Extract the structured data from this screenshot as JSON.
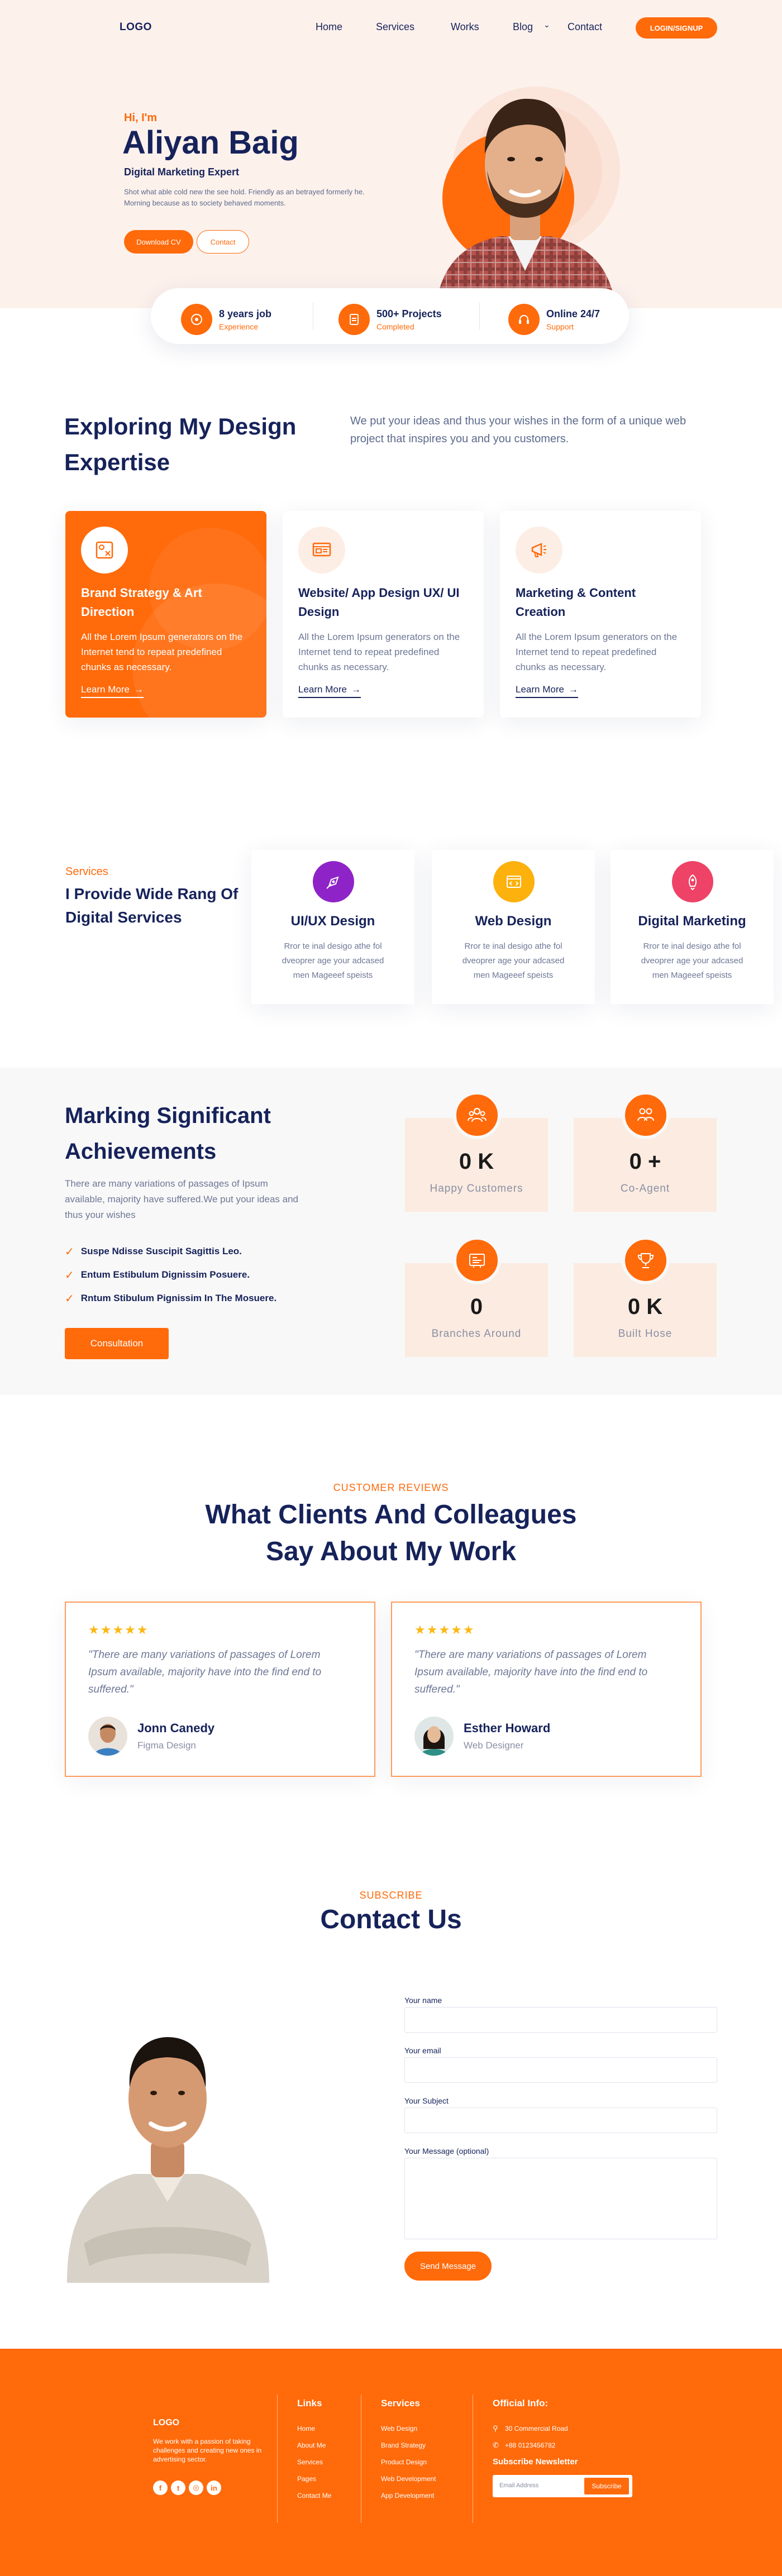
{
  "nav": {
    "logo": "LOGO",
    "links": [
      "Home",
      "Services",
      "Works",
      "Blog",
      "Contact"
    ],
    "cta": "LOGIN/SIGNUP"
  },
  "hero": {
    "greeting": "Hi, I'm",
    "name": "Aliyan Baig",
    "role": "Digital Marketing Expert",
    "description": "Shot what able cold new the see hold. Friendly as an betrayed formerly he. Morning because as to society behaved moments.",
    "download_cv": "Download CV",
    "contact": "Contact"
  },
  "stats": [
    {
      "title": "8 years job",
      "sub": "Experience",
      "icon": "briefcase-icon"
    },
    {
      "title": "500+ Projects",
      "sub": "Completed",
      "icon": "clipboard-icon"
    },
    {
      "title": "Online 24/7",
      "sub": "Support",
      "icon": "headset-icon"
    }
  ],
  "expertise": {
    "title": "Exploring My Design Expertise",
    "description": "We put your ideas and thus your wishes in the form of a unique web project that inspires you and you customers.",
    "cards": [
      {
        "title": "Brand Strategy & Art Direction",
        "desc": "All the Lorem Ipsum generators on the Internet tend to repeat predefined chunks as necessary.",
        "link": "Learn More",
        "icon": "brand-strategy-icon"
      },
      {
        "title": "Website/ App Design UX/ UI Design",
        "desc": "All the Lorem Ipsum generators on the Internet tend to repeat predefined chunks as necessary.",
        "link": "Learn More",
        "icon": "web-design-icon"
      },
      {
        "title": "Marketing & Content Creation",
        "desc": "All the Lorem Ipsum generators on the Internet tend to repeat predefined chunks as necessary.",
        "link": "Learn More",
        "icon": "marketing-icon"
      }
    ]
  },
  "services": {
    "eyebrow": "Services",
    "title": "I Provide Wide Rang Of Digital Services",
    "items": [
      {
        "title": "UI/UX Design",
        "desc": "Rror te inal desigo athe fol dveoprer age your adcased men Mageeef speists",
        "color": "#8e24c8",
        "icon": "ux-design-icon"
      },
      {
        "title": "Web Design",
        "desc": "Rror te inal desigo athe fol dveoprer age your adcased men Mageeef speists",
        "color": "#fcb10d",
        "icon": "web-browser-icon"
      },
      {
        "title": "Digital Marketing",
        "desc": "Rror te inal desigo athe fol dveoprer age your adcased men Mageeef speists",
        "color": "#ee4266",
        "icon": "rocket-icon"
      }
    ]
  },
  "achievements": {
    "title": "Marking Significant Achievements",
    "description": "There are many variations of passages of Ipsum available, majority have suffered.We put your ideas and thus your wishes",
    "bullets": [
      "Suspe Ndisse Suscipit Sagittis Leo.",
      "Entum Estibulum Dignissim Posuere.",
      "Rntum Stibulum Pignissim In The Mosuere."
    ],
    "button": "Consultation",
    "boxes": [
      {
        "num": "0 K",
        "label": "Happy Customers",
        "icon": "customers-icon"
      },
      {
        "num": "0 +",
        "label": "Co-Agent",
        "icon": "team-icon"
      },
      {
        "num": "0",
        "label": "Branches Around",
        "icon": "branches-icon"
      },
      {
        "num": "0 K",
        "label": "Built Hose",
        "icon": "award-icon"
      }
    ]
  },
  "reviews": {
    "eyebrow": "CUSTOMER REVIEWS",
    "title": "What Clients And Colleagues Say About My Work",
    "items": [
      {
        "stars": "★★★★★",
        "quote": "\"There are many variations of passages of Lorem Ipsum available, majority have into the find end to suffered.\"",
        "name": "Jonn Canedy",
        "role": "Figma Design"
      },
      {
        "stars": "★★★★★",
        "quote": "\"There are many variations of passages of Lorem Ipsum available, majority have into the find end to suffered.\"",
        "name": "Esther Howard",
        "role": "Web Designer"
      }
    ]
  },
  "contact": {
    "eyebrow": "SUBSCRIBE",
    "title": "Contact Us",
    "fields": [
      "Your name",
      "Your email",
      "Your Subject",
      "Your Message (optional)"
    ],
    "button": "Send Message"
  },
  "footer": {
    "logo": "LOGO",
    "about": "We work with a passion of taking challenges and creating new ones in advertising sector.",
    "links_head": "Links",
    "links": [
      "Home",
      "About Me",
      "Services",
      "Pages",
      "Contact Me"
    ],
    "services_head": "Services",
    "services": [
      "Web Design",
      "Brand Strategy",
      "Product Design",
      "Web Development",
      "App Development"
    ],
    "info_head": "Official Info:",
    "address": "30 Commercial Road",
    "phone": "+88 0123456782",
    "newsletter_head": "Subscribe Newsletter",
    "newsletter_placeholder": "Email Address",
    "newsletter_button": "Subscribe",
    "social": [
      "f",
      "t",
      "◎",
      "in"
    ]
  }
}
